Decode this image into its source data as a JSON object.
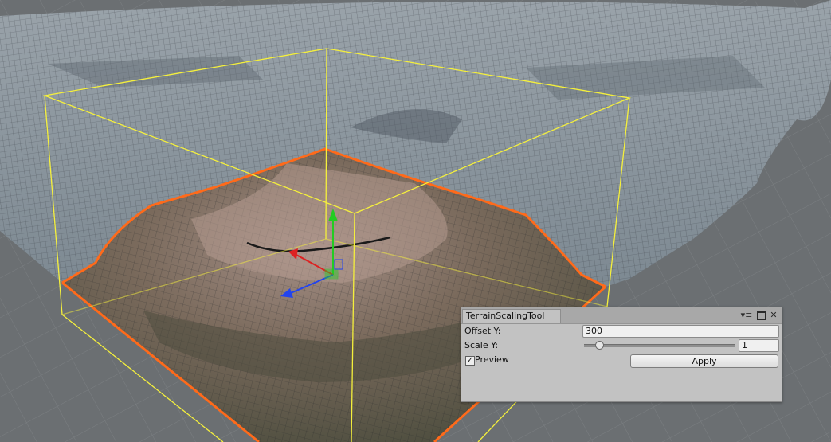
{
  "scene": {
    "terrain_color": "#8a949c",
    "ground_color": "#6b6f72",
    "selection_box_color": "#f5f03c",
    "terrain_outline_color": "#ff6a1a",
    "gizmo": {
      "y_axis_color": "#22cc22",
      "x_axis_color": "#dd2222",
      "z_axis_color": "#2244ee"
    }
  },
  "window": {
    "tab_title": "TerrainScalingTool",
    "menu_icon": "menu-icon",
    "maximize_icon": "maximize-icon",
    "close_icon": "close-icon",
    "menu_glyph": "▾≡",
    "close_glyph": "✕"
  },
  "fields": {
    "offset_y_label": "Offset Y:",
    "offset_y_value": "300",
    "scale_y_label": "Scale Y:",
    "scale_y_value": "1",
    "scale_y_slider_level": 0.1
  },
  "preview": {
    "label": "Preview",
    "checked": true,
    "check_glyph": "✓"
  },
  "apply_label": "Apply"
}
